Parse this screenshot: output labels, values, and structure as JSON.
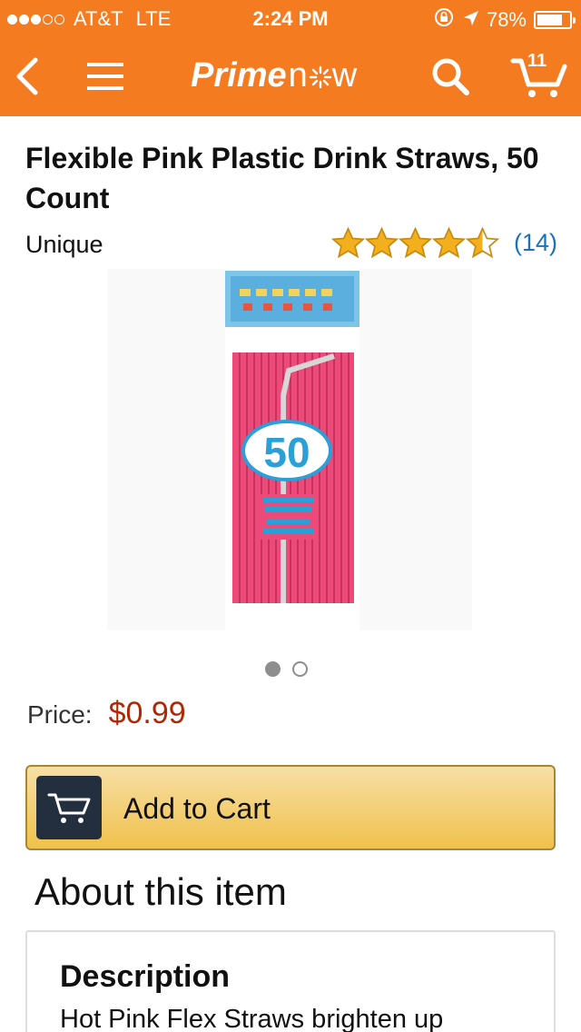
{
  "status_bar": {
    "carrier": "AT&T",
    "network": "LTE",
    "time": "2:24 PM",
    "battery": "78%",
    "battery_level": 0.78,
    "signal_bars": 3,
    "signal_max": 5
  },
  "nav": {
    "back_icon": "chevron-left-icon",
    "menu_icon": "hamburger-menu-icon",
    "logo_prime": "Prime",
    "logo_now": "now",
    "search_icon": "search-icon",
    "cart_icon": "cart-icon",
    "cart_count": "11"
  },
  "product": {
    "title": "Flexible Pink Plastic Drink Straws, 50 Count",
    "brand": "Unique",
    "rating": 4.5,
    "rating_max": 5,
    "review_count": "(14)",
    "image_count": 2,
    "active_image": 0,
    "price_label": "Price:",
    "price": "$0.99",
    "add_to_cart": "Add to Cart"
  },
  "about": {
    "heading": "About this item",
    "description_heading": "Description",
    "description_text": "Hot Pink Flex Straws brighten up"
  },
  "colors": {
    "brand_orange": "#f47b20",
    "price_red": "#b12704",
    "link_blue": "#1a72b8",
    "star_gold": "#f2b01e",
    "button_gold": "#f0c14b",
    "cart_icon_bg": "#232f3e",
    "straw_pink": "#ec4a79"
  }
}
